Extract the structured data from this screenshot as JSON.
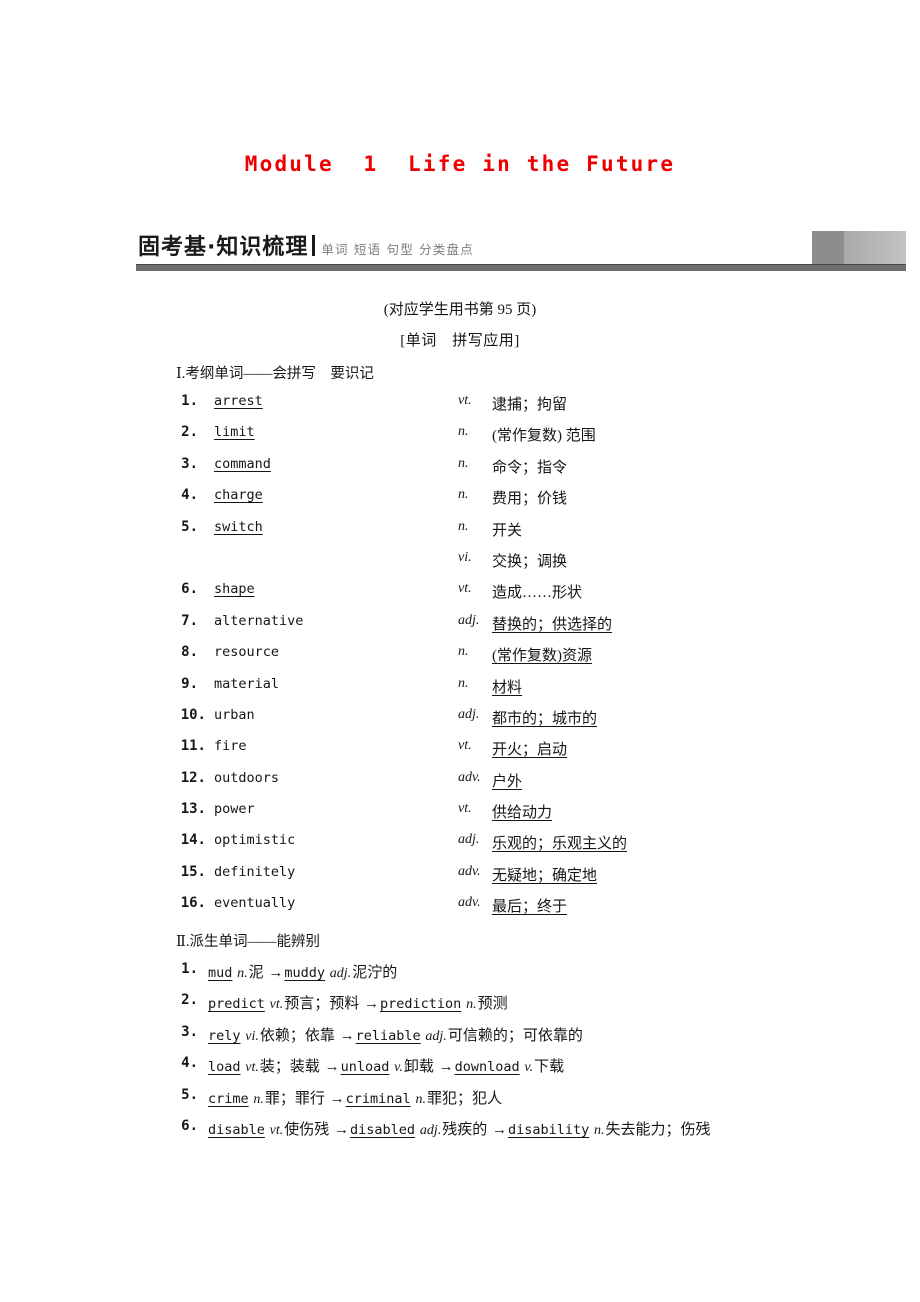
{
  "module_title": "Module  1  Life in the Future",
  "banner": {
    "main": "固考基·知识梳理",
    "sub": "单词 短语 句型 分类盘点"
  },
  "book_reference": "(对应学生用书第 95 页)",
  "bracket_heading": "[单词　拼写应用]",
  "section1": {
    "heading": "Ⅰ.考纲单词——会拼写　要识记",
    "items": [
      {
        "num": "1.",
        "word": "arrest",
        "word_underlined": true,
        "pos": "vt.",
        "def": "逮捕；拘留",
        "def_underlined": false
      },
      {
        "num": "2.",
        "word": "limit",
        "word_underlined": true,
        "pos": "n.",
        "def": "(常作复数) 范围",
        "def_underlined": false
      },
      {
        "num": "3.",
        "word": "command",
        "word_underlined": true,
        "pos": "n.",
        "def": "命令；指令",
        "def_underlined": false
      },
      {
        "num": "4.",
        "word": "charge",
        "word_underlined": true,
        "pos": "n.",
        "def": "费用；价钱",
        "def_underlined": false
      },
      {
        "num": "5.",
        "word": "switch",
        "word_underlined": true,
        "pos": "n.",
        "def": "开关",
        "def_underlined": false
      },
      {
        "num": "",
        "word": "",
        "word_underlined": false,
        "pos": "vi.",
        "def": "交换；调换",
        "def_underlined": false
      },
      {
        "num": "6.",
        "word": "shape",
        "word_underlined": true,
        "pos": "vt.",
        "def": "造成……形状",
        "def_underlined": false
      },
      {
        "num": "7.",
        "word": "alternative",
        "word_underlined": false,
        "pos": "adj.",
        "def": "替换的；供选择的",
        "def_underlined": true
      },
      {
        "num": "8.",
        "word": "resource",
        "word_underlined": false,
        "pos": "n.",
        "def": "(常作复数)资源",
        "def_underlined": true
      },
      {
        "num": "9.",
        "word": "material",
        "word_underlined": false,
        "pos": "n.",
        "def": "材料",
        "def_underlined": true
      },
      {
        "num": "10.",
        "word": "urban",
        "word_underlined": false,
        "pos": "adj.",
        "def": "都市的；城市的",
        "def_underlined": true
      },
      {
        "num": "11.",
        "word": "fire",
        "word_underlined": false,
        "pos": "vt.",
        "def": "开火；启动",
        "def_underlined": true
      },
      {
        "num": "12.",
        "word": "outdoors",
        "word_underlined": false,
        "pos": "adv.",
        "def": "户外",
        "def_underlined": true
      },
      {
        "num": "13.",
        "word": "power",
        "word_underlined": false,
        "pos": "vt.",
        "def": "供给动力",
        "def_underlined": true
      },
      {
        "num": "14.",
        "word": "optimistic",
        "word_underlined": false,
        "pos": "adj.",
        "def": "乐观的；乐观主义的",
        "def_underlined": true
      },
      {
        "num": "15.",
        "word": "definitely",
        "word_underlined": false,
        "pos": "adv.",
        "def": "无疑地；确定地",
        "def_underlined": true
      },
      {
        "num": "16.",
        "word": "eventually",
        "word_underlined": false,
        "pos": "adv.",
        "def": "最后；终于",
        "def_underlined": true
      }
    ]
  },
  "section2": {
    "heading": "Ⅱ.派生单词——能辨别",
    "items": [
      {
        "num": "1.",
        "parts": [
          {
            "t": "en",
            "v": "mud"
          },
          {
            "t": "pos",
            "v": "n."
          },
          {
            "t": "cn",
            "v": "泥"
          },
          {
            "t": "arrow",
            "v": "→"
          },
          {
            "t": "en",
            "v": "muddy"
          },
          {
            "t": "pos",
            "v": "adj."
          },
          {
            "t": "cn",
            "v": "泥泞的"
          }
        ]
      },
      {
        "num": "2.",
        "parts": [
          {
            "t": "en",
            "v": "predict"
          },
          {
            "t": "pos",
            "v": "vt."
          },
          {
            "t": "cn",
            "v": "预言；预料"
          },
          {
            "t": "arrow",
            "v": "→"
          },
          {
            "t": "en",
            "v": "prediction"
          },
          {
            "t": "pos",
            "v": "n."
          },
          {
            "t": "cn",
            "v": "预测"
          }
        ]
      },
      {
        "num": "3.",
        "parts": [
          {
            "t": "en",
            "v": "rely"
          },
          {
            "t": "pos",
            "v": "vi."
          },
          {
            "t": "cn",
            "v": "依赖；依靠"
          },
          {
            "t": "arrow",
            "v": "→"
          },
          {
            "t": "en",
            "v": "reliable"
          },
          {
            "t": "pos",
            "v": "adj."
          },
          {
            "t": "cn",
            "v": "可信赖的；可依靠的"
          }
        ]
      },
      {
        "num": "4.",
        "parts": [
          {
            "t": "en",
            "v": "load"
          },
          {
            "t": "pos",
            "v": "vt."
          },
          {
            "t": "cn",
            "v": "装；装载"
          },
          {
            "t": "arrow",
            "v": "→"
          },
          {
            "t": "en",
            "v": "unload"
          },
          {
            "t": "pos",
            "v": "v."
          },
          {
            "t": "cn",
            "v": "卸载"
          },
          {
            "t": "arrow",
            "v": "→"
          },
          {
            "t": "en",
            "v": "download"
          },
          {
            "t": "pos",
            "v": "v."
          },
          {
            "t": "cn",
            "v": "下载"
          }
        ]
      },
      {
        "num": "5.",
        "parts": [
          {
            "t": "en",
            "v": "crime"
          },
          {
            "t": "pos",
            "v": "n."
          },
          {
            "t": "cn",
            "v": "罪；罪行"
          },
          {
            "t": "arrow",
            "v": "→"
          },
          {
            "t": "en",
            "v": "criminal"
          },
          {
            "t": "pos",
            "v": "n."
          },
          {
            "t": "cn",
            "v": "罪犯；犯人"
          }
        ]
      },
      {
        "num": "6.",
        "parts": [
          {
            "t": "en",
            "v": "disable"
          },
          {
            "t": "pos",
            "v": "vt."
          },
          {
            "t": "cn",
            "v": "使伤残"
          },
          {
            "t": "arrow",
            "v": "→"
          },
          {
            "t": "en",
            "v": "disabled"
          },
          {
            "t": "pos",
            "v": "adj."
          },
          {
            "t": "cn",
            "v": "残疾的"
          },
          {
            "t": "arrow",
            "v": "→"
          },
          {
            "t": "en",
            "v": "disability"
          },
          {
            "t": "pos",
            "v": "n."
          },
          {
            "t": "cn",
            "v": "失去能力；伤残"
          }
        ]
      }
    ]
  },
  "colors": {
    "title_red": "#ee0000",
    "banner_dark": "#1a1a1a",
    "banner_sub_gray": "#7d7d7d",
    "rule_gray": "#6e6e6e"
  }
}
